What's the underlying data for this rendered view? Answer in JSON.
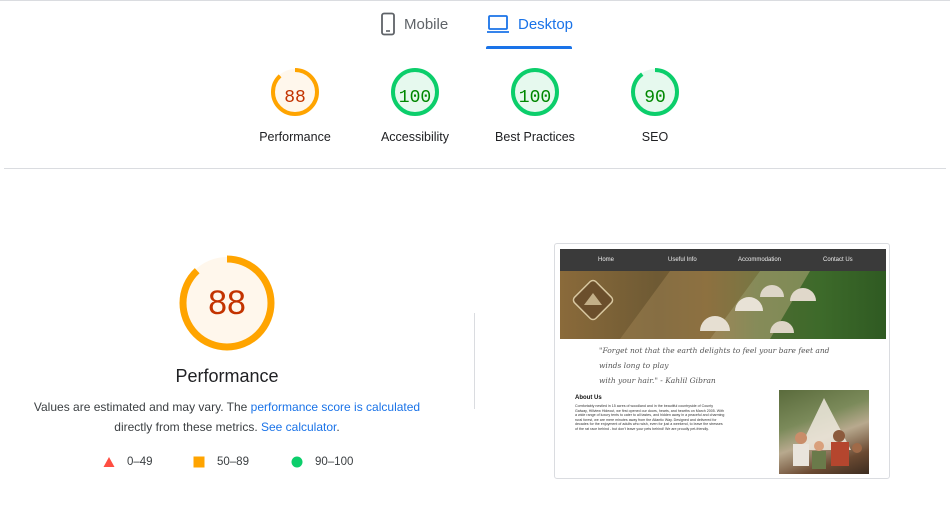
{
  "tabs": {
    "mobile_label": "Mobile",
    "desktop_label": "Desktop",
    "active": "desktop"
  },
  "categories": [
    {
      "name": "Performance",
      "score": 88,
      "color": "#ffa400",
      "text_color": "#c33300",
      "bg": "#fff7ec"
    },
    {
      "name": "Accessibility",
      "score": 100,
      "color": "#0cce6b",
      "text_color": "#008800",
      "bg": "#e6f9ee"
    },
    {
      "name": "Best Practices",
      "score": 100,
      "color": "#0cce6b",
      "text_color": "#008800",
      "bg": "#e6f9ee"
    },
    {
      "name": "SEO",
      "score": 90,
      "color": "#0cce6b",
      "text_color": "#008800",
      "bg": "#e6f9ee"
    }
  ],
  "detail": {
    "score": 88,
    "title": "Performance",
    "desc_prefix": "Values are estimated and may vary. The ",
    "desc_link1": "performance score is calculated",
    "desc_middle": " directly from these metrics. ",
    "desc_link2": "See calculator",
    "desc_suffix": "."
  },
  "legend": [
    {
      "shape": "triangle",
      "color": "#ff4e42",
      "label": "0–49"
    },
    {
      "shape": "square",
      "color": "#ffa400",
      "label": "50–89"
    },
    {
      "shape": "circle",
      "color": "#0cce6b",
      "label": "90–100"
    }
  ],
  "screenshot": {
    "nav": [
      "Home",
      "Useful Info",
      "Accommodation",
      "Contact Us"
    ],
    "quote_line1": "\"Forget not that the earth delights to feel your bare feet and winds long to play",
    "quote_line2": "with your hair.\" - Kahlil Gibran",
    "about_title": "About Us",
    "about_text": "Comfortably nestled in 15 acres of woodland and in the beautiful countryside of County Galway, Hillview Hideout, we first opened our doors, hearts, and hearths on March 2005. With a wide range of luxury tents to cater to all tastes, and hidden away in a peaceful and charming rural forest, we are mere minutes away from the Atlantic Way. Designed and delivered for decades for the enjoyment of adults who wish, even for just a weekend, to leave the stresses of the rat race behind - but don't leave your pets behind! We are proudly pet-friendly."
  }
}
